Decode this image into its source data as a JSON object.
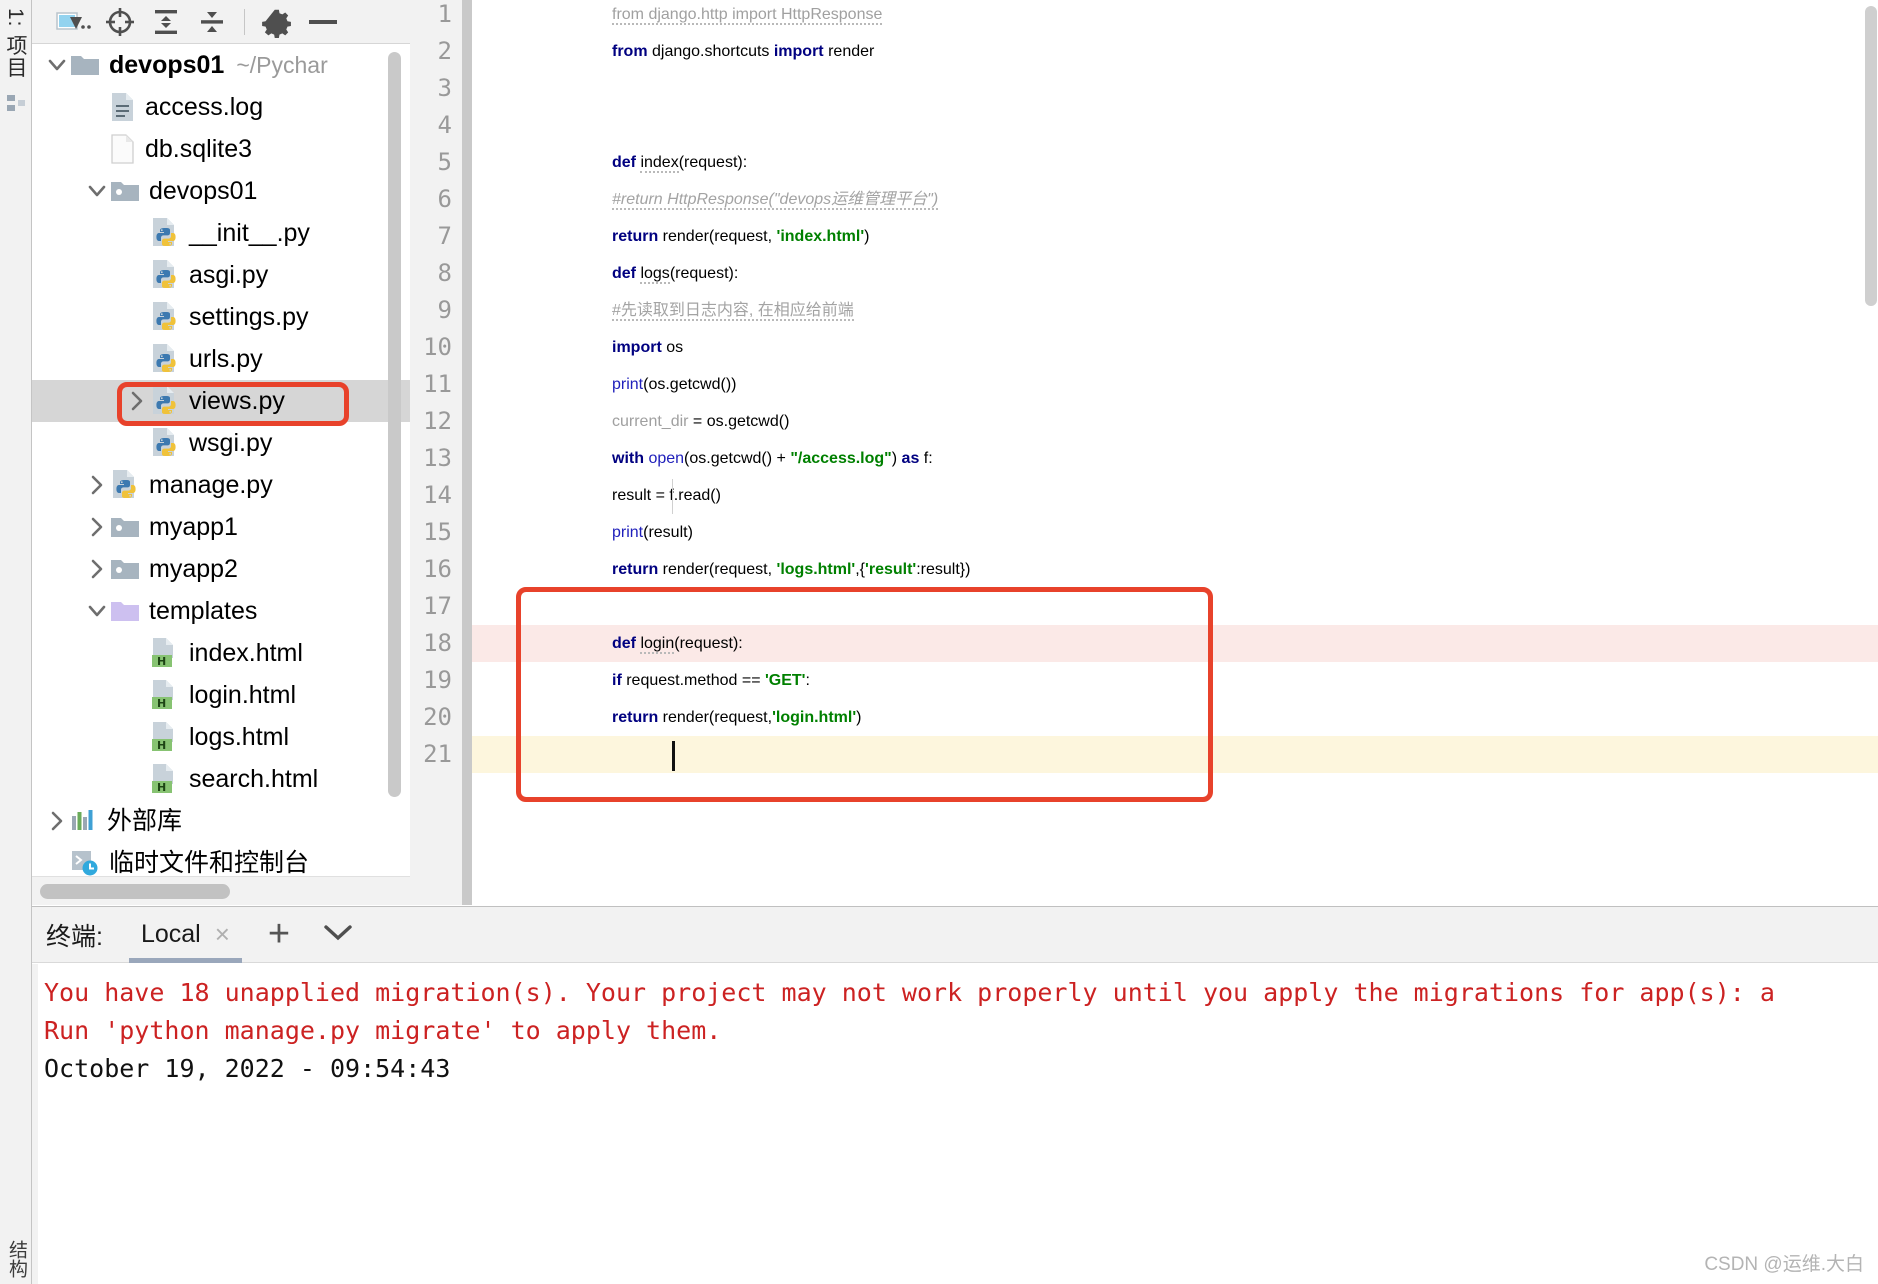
{
  "vertical_strip": {
    "project_label": "1: 项目",
    "bottom_label": "结构"
  },
  "project_toolbar": {
    "buttons": [
      {
        "name": "select-opened-file",
        "icon": "folder-arrow-icon",
        "label": ".."
      },
      {
        "name": "scroll-from-source",
        "icon": "target-icon",
        "label": ""
      },
      {
        "name": "expand-all",
        "icon": "expand-all-icon",
        "label": ""
      },
      {
        "name": "collapse-all",
        "icon": "collapse-all-icon",
        "label": ""
      },
      {
        "name": "settings",
        "icon": "gear-icon",
        "label": ""
      },
      {
        "name": "hide",
        "icon": "minimize-icon",
        "label": ""
      }
    ]
  },
  "tree": [
    {
      "label": "devops01",
      "hint": "~/Pychar",
      "icon": "folder-root-icon",
      "arrow": "down",
      "indent": 0,
      "bold": true,
      "selected": false
    },
    {
      "label": "access.log",
      "hint": "",
      "icon": "log-file-icon",
      "arrow": "none",
      "indent": 1,
      "bold": false,
      "selected": false
    },
    {
      "label": "db.sqlite3",
      "hint": "",
      "icon": "generic-file-icon",
      "arrow": "none",
      "indent": 1,
      "bold": false,
      "selected": false
    },
    {
      "label": "devops01",
      "hint": "",
      "icon": "folder-icon",
      "arrow": "down",
      "indent": 1,
      "bold": false,
      "selected": false
    },
    {
      "label": "__init__.py",
      "hint": "",
      "icon": "python-file-icon",
      "arrow": "none",
      "indent": 2,
      "bold": false,
      "selected": false
    },
    {
      "label": "asgi.py",
      "hint": "",
      "icon": "python-file-icon",
      "arrow": "none",
      "indent": 2,
      "bold": false,
      "selected": false
    },
    {
      "label": "settings.py",
      "hint": "",
      "icon": "python-file-icon",
      "arrow": "none",
      "indent": 2,
      "bold": false,
      "selected": false
    },
    {
      "label": "urls.py",
      "hint": "",
      "icon": "python-file-icon",
      "arrow": "none",
      "indent": 2,
      "bold": false,
      "selected": false
    },
    {
      "label": "views.py",
      "hint": "",
      "icon": "python-file-icon",
      "arrow": "right",
      "indent": 2,
      "bold": false,
      "selected": true
    },
    {
      "label": "wsgi.py",
      "hint": "",
      "icon": "python-file-icon",
      "arrow": "none",
      "indent": 2,
      "bold": false,
      "selected": false
    },
    {
      "label": "manage.py",
      "hint": "",
      "icon": "python-file-icon",
      "arrow": "right",
      "indent": 1,
      "bold": false,
      "selected": false
    },
    {
      "label": "myapp1",
      "hint": "",
      "icon": "folder-icon",
      "arrow": "right",
      "indent": 1,
      "bold": false,
      "selected": false
    },
    {
      "label": "myapp2",
      "hint": "",
      "icon": "folder-icon",
      "arrow": "right",
      "indent": 1,
      "bold": false,
      "selected": false
    },
    {
      "label": "templates",
      "hint": "",
      "icon": "folder-templates-icon",
      "arrow": "down",
      "indent": 1,
      "bold": false,
      "selected": false
    },
    {
      "label": "index.html",
      "hint": "",
      "icon": "html-file-icon",
      "arrow": "none",
      "indent": 2,
      "bold": false,
      "selected": false
    },
    {
      "label": "login.html",
      "hint": "",
      "icon": "html-file-icon",
      "arrow": "none",
      "indent": 2,
      "bold": false,
      "selected": false
    },
    {
      "label": "logs.html",
      "hint": "",
      "icon": "html-file-icon",
      "arrow": "none",
      "indent": 2,
      "bold": false,
      "selected": false
    },
    {
      "label": "search.html",
      "hint": "",
      "icon": "html-file-icon",
      "arrow": "none",
      "indent": 2,
      "bold": false,
      "selected": false
    },
    {
      "label": "外部库",
      "hint": "",
      "icon": "external-libraries-icon",
      "arrow": "right",
      "indent": 0,
      "bold": false,
      "selected": false
    },
    {
      "label": "临时文件和控制台",
      "hint": "",
      "icon": "scratches-icon",
      "arrow": "none",
      "indent": 0,
      "bold": false,
      "selected": false
    }
  ],
  "editor": {
    "lines": [
      {
        "n": "1",
        "state": "normal"
      },
      {
        "n": "2",
        "state": "normal"
      },
      {
        "n": "3",
        "state": "normal"
      },
      {
        "n": "4",
        "state": "normal"
      },
      {
        "n": "5",
        "state": "normal"
      },
      {
        "n": "6",
        "state": "normal"
      },
      {
        "n": "7",
        "state": "normal"
      },
      {
        "n": "8",
        "state": "normal"
      },
      {
        "n": "9",
        "state": "normal"
      },
      {
        "n": "10",
        "state": "normal"
      },
      {
        "n": "11",
        "state": "normal"
      },
      {
        "n": "12",
        "state": "normal"
      },
      {
        "n": "13",
        "state": "normal"
      },
      {
        "n": "14",
        "state": "normal"
      },
      {
        "n": "15",
        "state": "normal"
      },
      {
        "n": "16",
        "state": "normal"
      },
      {
        "n": "17",
        "state": "normal"
      },
      {
        "n": "18",
        "state": "error"
      },
      {
        "n": "19",
        "state": "normal"
      },
      {
        "n": "20",
        "state": "normal"
      },
      {
        "n": "21",
        "state": "current"
      }
    ],
    "source": [
      "from django.http import HttpResponse",
      "from django.shortcuts import render",
      "",
      "",
      "def index(request):",
      "    #return HttpResponse(\"devops运维管理平台\")",
      "    return render(request, 'index.html')",
      "def logs(request):",
      "    #先读取到日志内容, 在相应给前端",
      "    import os",
      "    print(os.getcwd())",
      "    current_dir = os.getcwd()",
      "    with open(os.getcwd() + \"/access.log\") as f:",
      "        result = f.read()",
      "    print(result)",
      "    return render(request, 'logs.html',{'result':result})",
      "",
      "def login(request):",
      "    if request.method == 'GET':",
      "        return render(request,'login.html')",
      ""
    ]
  },
  "terminal": {
    "title": "终端:",
    "tab_label": "Local",
    "close_label": "×",
    "add_label": "+",
    "output": [
      {
        "text": "You have 18 unapplied migration(s). Your project may not work properly until you apply the migrations for app(s): a",
        "color": "red"
      },
      {
        "text": "Run 'python manage.py migrate' to apply them.",
        "color": "red"
      },
      {
        "text": "October 19, 2022 - 09:54:43",
        "color": "black"
      }
    ]
  },
  "watermark": "CSDN @运维.大白",
  "colors": {
    "annotation": "#e8422b",
    "selection": "#d6d6d6",
    "error_line": "#fbe9e7",
    "current_line": "#fdf6dd",
    "keyword": "#000080",
    "string": "#008000",
    "comment": "#a3a3a3",
    "terminal_error": "#cc2222"
  }
}
